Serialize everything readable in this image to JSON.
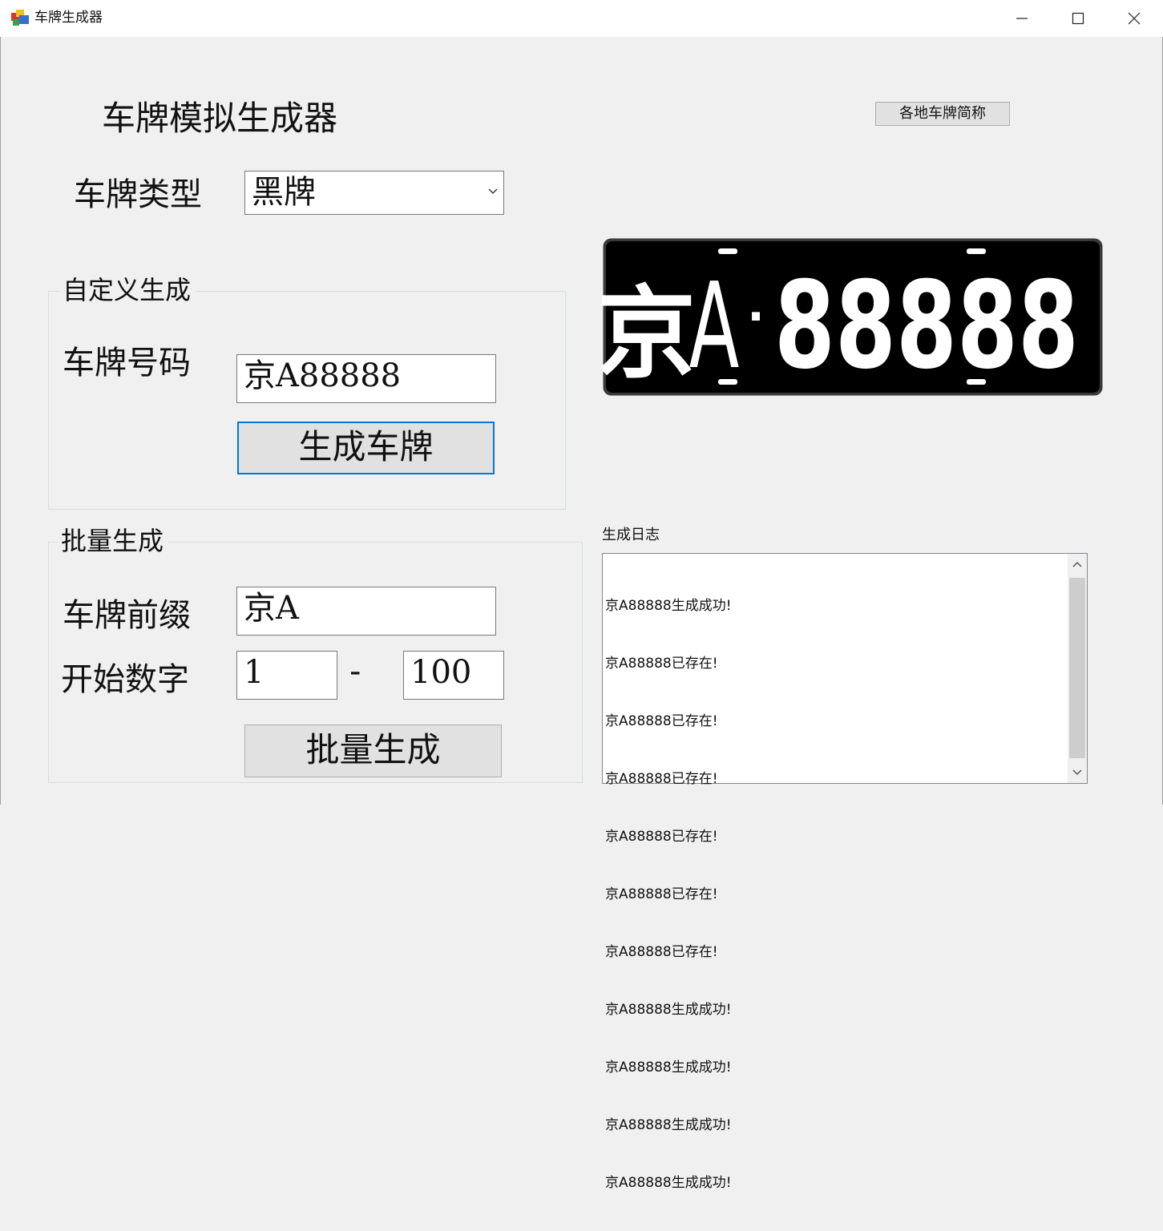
{
  "window": {
    "title": "车牌生成器"
  },
  "header": {
    "title": "车牌模拟生成器",
    "abbr_button": "各地车牌简称"
  },
  "plate_type": {
    "label": "车牌类型",
    "selected": "黑牌"
  },
  "custom": {
    "legend": "自定义生成",
    "plate_label": "车牌号码",
    "plate_value": "京A88888",
    "generate_button": "生成车牌"
  },
  "batch": {
    "legend": "批量生成",
    "prefix_label": "车牌前缀",
    "prefix_value": "京A",
    "start_label": "开始数字",
    "start_value": "1",
    "range_separator": "-",
    "end_value": "100",
    "batch_button": "批量生成"
  },
  "preview": {
    "province": "京",
    "letter": "A",
    "separator": "·",
    "digits": "88888",
    "background_color": "#000000",
    "text_color": "#ffffff"
  },
  "log": {
    "label": "生成日志",
    "lines": [
      "京A88888生成成功!",
      "京A88888已存在!",
      "京A88888已存在!",
      "京A88888已存在!",
      "京A88888已存在!",
      "京A88888已存在!",
      "京A88888已存在!",
      "京A88888生成成功!",
      "京A88888生成成功!",
      "京A88888生成成功!",
      "京A88888生成成功!"
    ]
  },
  "icons": {
    "app": "app-icon",
    "minimize": "minimize-icon",
    "maximize": "maximize-icon",
    "close": "close-icon",
    "dropdown": "chevron-down-icon"
  },
  "colors": {
    "accent": "#0078d7",
    "window_bg": "#f0f0f0"
  }
}
